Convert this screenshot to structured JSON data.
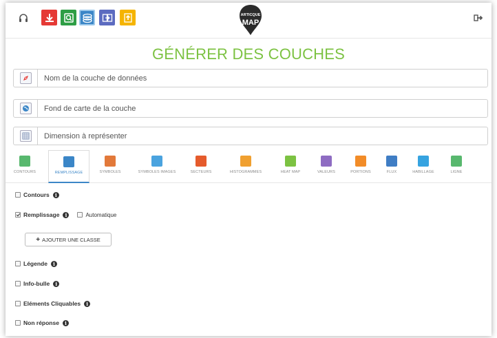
{
  "topbar": {
    "icons": [
      {
        "name": "headphones-icon",
        "color": "#555555"
      },
      {
        "name": "download-icon",
        "color": "#e53935"
      },
      {
        "name": "search-icon",
        "color": "#2e9e45"
      },
      {
        "name": "layers-icon",
        "color": "#3b86c7"
      },
      {
        "name": "transfer-icon",
        "color": "#5c6bc0"
      },
      {
        "name": "upload-icon",
        "color": "#f5b400"
      }
    ],
    "logo": {
      "line1": "ARTICQUE",
      "line2": "MAP"
    },
    "exit_icon": "sign-out-icon"
  },
  "page_title": "GÉNÉRER DES COUCHES",
  "fields": [
    {
      "placeholder": "Nom de la couche de données",
      "icon": "layer-name-icon"
    },
    {
      "placeholder": "Fond de carte de la couche",
      "icon": "basemap-icon"
    },
    {
      "placeholder": "Dimension à représenter",
      "icon": "dimension-icon"
    }
  ],
  "tabs": [
    {
      "label": "CONTOURS",
      "color": "#58b86e"
    },
    {
      "label": "REMPLISSAGE",
      "color": "#3b86c7",
      "active": true
    },
    {
      "label": "SYMBOLES",
      "color": "#e2793a"
    },
    {
      "label": "SYMBOLES IMAGES",
      "color": "#4aa3df"
    },
    {
      "label": "SECTEURS",
      "color": "#e55b2c"
    },
    {
      "label": "HISTOGRAMMES",
      "color": "#f0a030"
    },
    {
      "label": "HEAT MAP",
      "color": "#7cc242"
    },
    {
      "label": "VALEURS",
      "color": "#8e6cc2"
    },
    {
      "label": "PORTIONS",
      "color": "#f28c28"
    },
    {
      "label": "FLUX",
      "color": "#3f7dc4"
    },
    {
      "label": "HABILLAGE",
      "color": "#36a3e0"
    },
    {
      "label": "LIGNE",
      "color": "#58b86e"
    }
  ],
  "options": {
    "contours": {
      "label": "Contours",
      "checked": false
    },
    "remplissage": {
      "label": "Remplissage",
      "checked": true
    },
    "automatique": {
      "label": "Automatique",
      "checked": false
    },
    "add_class_button": "AJOUTER UNE CLASSE",
    "legende": {
      "label": "Légende",
      "checked": false
    },
    "info_bulle": {
      "label": "Info-bulle",
      "checked": false
    },
    "elements_cliquables": {
      "label": "Eléments Cliquables",
      "checked": false
    },
    "non_reponse": {
      "label": "Non réponse",
      "checked": false
    }
  },
  "accent_color": "#7cc242"
}
